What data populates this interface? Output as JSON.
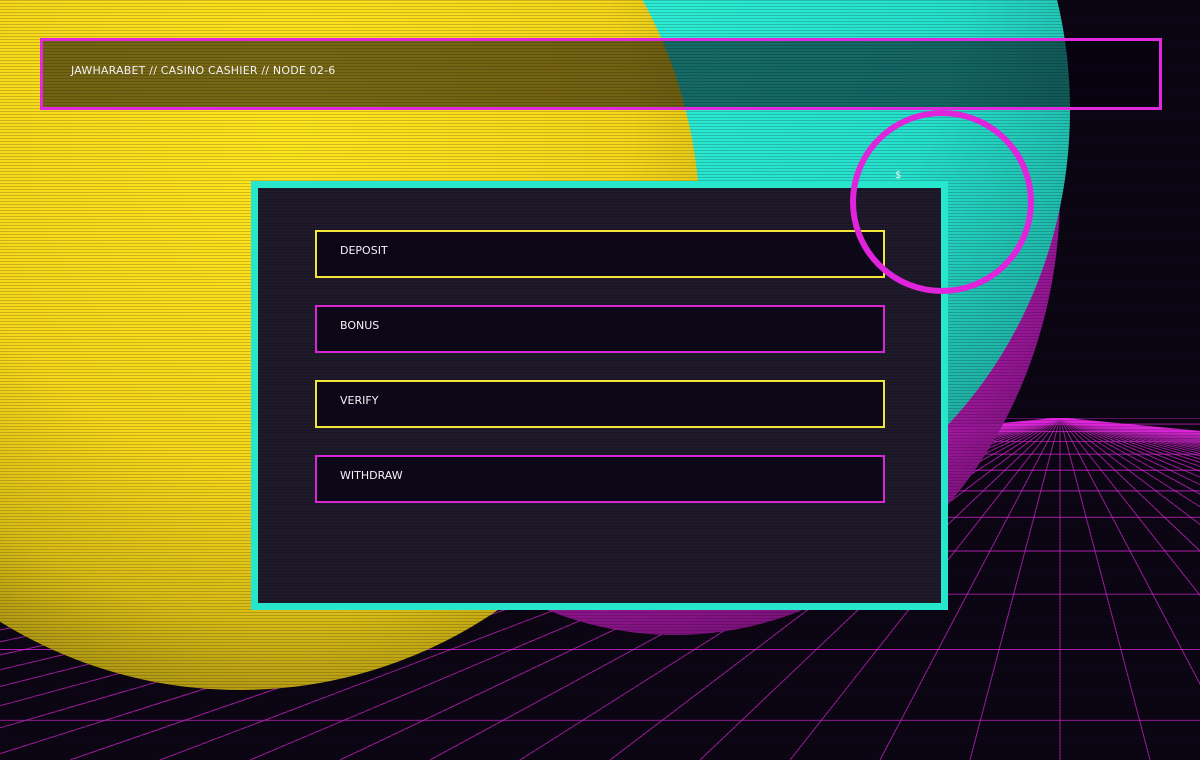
{
  "header": {
    "title": "JAWHARABET // CASINO CASHIER // NODE 02-6"
  },
  "menu": {
    "items": [
      {
        "label": "DEPOSIT",
        "accent": "#f1e53a"
      },
      {
        "label": "BONUS",
        "accent": "#d926d2"
      },
      {
        "label": "VERIFY",
        "accent": "#f1e53a"
      },
      {
        "label": "WITHDRAW",
        "accent": "#d926d2"
      }
    ]
  },
  "ring": {
    "symbol": "$"
  },
  "colors": {
    "magenta": "#e028dc",
    "cyan": "#26e6cc",
    "yellow": "#f1e53a",
    "background": "#0c0614",
    "panel": "#1b1726"
  }
}
